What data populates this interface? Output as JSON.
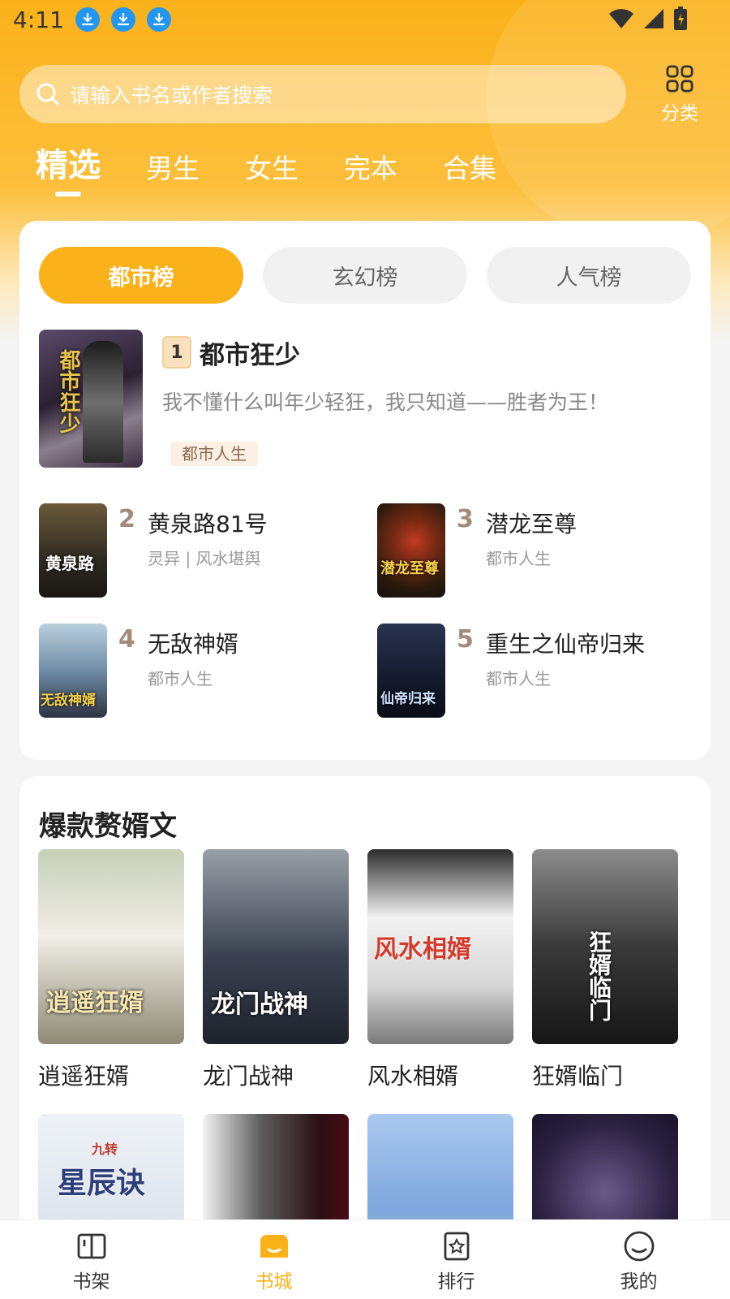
{
  "status_bar": {
    "time": "4:11"
  },
  "search": {
    "placeholder": "请输入书名或作者搜索"
  },
  "category": {
    "label": "分类"
  },
  "tabs": [
    {
      "label": "精选",
      "active": true
    },
    {
      "label": "男生"
    },
    {
      "label": "女生"
    },
    {
      "label": "完本"
    },
    {
      "label": "合集"
    }
  ],
  "ranking": {
    "tabs": [
      {
        "label": "都市榜",
        "active": true
      },
      {
        "label": "玄幻榜"
      },
      {
        "label": "人气榜"
      }
    ],
    "top": {
      "rank": "1",
      "title": "都市狂少",
      "desc": "我不懂什么叫年少轻狂，我只知道——胜者为王！",
      "tag": "都市人生",
      "cover_text": "都市狂少"
    },
    "items": [
      {
        "rank": "2",
        "title": "黄泉路81号",
        "meta": "灵异 | 风水堪舆",
        "cover_text": "黄泉路"
      },
      {
        "rank": "3",
        "title": "潜龙至尊",
        "meta": "都市人生",
        "cover_text": "潜龙至尊"
      },
      {
        "rank": "4",
        "title": "无敌神婿",
        "meta": "都市人生",
        "cover_text": "无敌神婿"
      },
      {
        "rank": "5",
        "title": "重生之仙帝归来",
        "meta": "都市人生",
        "cover_text": "仙帝归来"
      }
    ]
  },
  "hot_section": {
    "title": "爆款赘婿文",
    "books": [
      {
        "title": "逍遥狂婿",
        "cover_text": "逍遥狂婿"
      },
      {
        "title": "龙门战神",
        "cover_text": "龙门战神"
      },
      {
        "title": "风水相婿",
        "cover_text": "风水相婿"
      },
      {
        "title": "狂婿临门",
        "cover_text": "狂婿临门"
      }
    ],
    "row2_cover_texts": [
      "星辰诀",
      "",
      "",
      ""
    ],
    "row2_badge": "九转"
  },
  "bottom_nav": [
    {
      "label": "书架",
      "icon": "book-open-icon"
    },
    {
      "label": "书城",
      "icon": "store-icon",
      "active": true
    },
    {
      "label": "排行",
      "icon": "rank-star-icon"
    },
    {
      "label": "我的",
      "icon": "smile-icon"
    }
  ],
  "colors": {
    "accent": "#fbb21a",
    "rank_num": "#a38b7b",
    "download_icon": "#2196f3"
  }
}
